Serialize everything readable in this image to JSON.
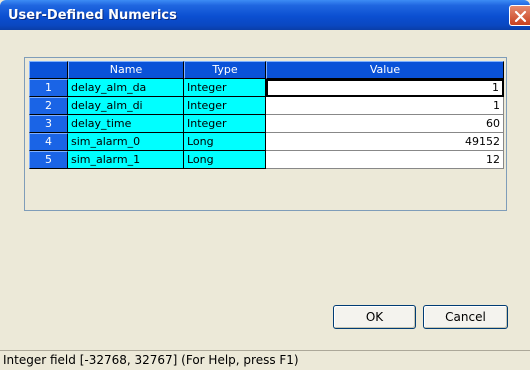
{
  "window": {
    "title": "User-Defined Numerics"
  },
  "grid": {
    "columns": [
      "Name",
      "Type",
      "Value"
    ],
    "rows": [
      {
        "num": "1",
        "name": "delay_alm_da",
        "type": "Integer",
        "value": "1"
      },
      {
        "num": "2",
        "name": "delay_alm_di",
        "type": "Integer",
        "value": "1"
      },
      {
        "num": "3",
        "name": "delay_time",
        "type": "Integer",
        "value": "60"
      },
      {
        "num": "4",
        "name": "sim_alarm_0",
        "type": "Long",
        "value": "49152"
      },
      {
        "num": "5",
        "name": "sim_alarm_1",
        "type": "Long",
        "value": "12"
      }
    ]
  },
  "buttons": {
    "ok": "OK",
    "cancel": "Cancel"
  },
  "status": "Integer field [-32768, 32767] (For Help, press F1)",
  "colors": {
    "header": "#0a52d8",
    "name_type_cells": "#00ffff",
    "titlebar": "#0b4fd1"
  },
  "icons": {
    "close": "close-icon"
  }
}
